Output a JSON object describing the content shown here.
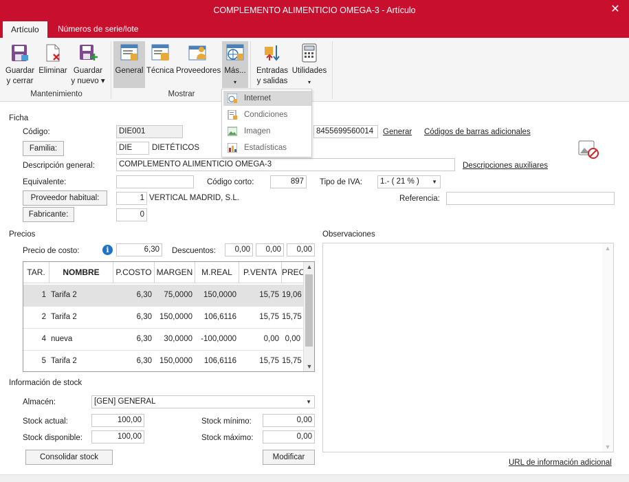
{
  "window": {
    "title": "COMPLEMENTO ALIMENTICIO OMEGA-3 - Artículo",
    "close_glyph": "✕"
  },
  "tabs": [
    "Artículo",
    "Números de serie/lote"
  ],
  "ribbon": {
    "groups": [
      {
        "label": "Mantenimiento",
        "buttons": [
          {
            "l1": "Guardar",
            "l2": "y cerrar",
            "icon": "save-close-icon"
          },
          {
            "l1": "Eliminar",
            "l2": "",
            "icon": "delete-icon"
          },
          {
            "l1": "Guardar",
            "l2": "y nuevo ▾",
            "icon": "save-new-icon"
          }
        ]
      },
      {
        "label": "Mostrar",
        "buttons": [
          {
            "l1": "General",
            "l2": "",
            "icon": "general-icon"
          },
          {
            "l1": "Técnica",
            "l2": "",
            "icon": "technical-icon"
          },
          {
            "l1": "Proveedores",
            "l2": "",
            "icon": "suppliers-icon"
          },
          {
            "l1": "Más...",
            "l2": "▾",
            "icon": "more-icon"
          }
        ]
      },
      {
        "label": "",
        "buttons": [
          {
            "l1": "Entradas",
            "l2": "y salidas",
            "icon": "in-out-icon"
          },
          {
            "l1": "Utilidades",
            "l2": "▾",
            "icon": "utilities-icon"
          }
        ]
      }
    ]
  },
  "mas_menu": [
    "Internet",
    "Condiciones",
    "Imagen",
    "Estadísticas"
  ],
  "ficha": {
    "section": "Ficha",
    "codigo_label": "Código:",
    "codigo": "DIE001",
    "barcode": "8455699560014",
    "generar": "Generar",
    "codigos_barras": "Códigos de barras adicionales",
    "familia_btn": "Familia:",
    "familia_code": "DIE",
    "familia_name": "DIETÉTICOS",
    "desc_label": "Descripción general:",
    "descripcion": "COMPLEMENTO ALIMENTICIO OMEGA-3",
    "desc_aux": "Descripciones auxiliares",
    "equivalente_label": "Equivalente:",
    "equivalente": "",
    "codigo_corto_label": "Código corto:",
    "codigo_corto": "897",
    "iva_label": "Tipo de IVA:",
    "iva": "1.- ( 21 % )",
    "proveedor_btn": "Proveedor habitual:",
    "proveedor_num": "1",
    "proveedor_name": "VERTICAL MADRID, S.L.",
    "referencia_label": "Referencia:",
    "referencia": "",
    "fabricante_btn": "Fabricante:",
    "fabricante": "0"
  },
  "precios": {
    "section": "Precios",
    "coste_label": "Precio de costo:",
    "coste": "6,30",
    "descuentos_label": "Descuentos:",
    "descuentos": [
      "0,00",
      "0,00",
      "0,00"
    ],
    "columns": [
      "TAR.",
      "NOMBRE",
      "P.COSTO",
      "MARGEN",
      "M.REAL",
      "P.VENTA",
      "PRECIO I/I"
    ],
    "rows": [
      [
        "1",
        "Tarifa 2",
        "6,30",
        "75,0000",
        "150,0000",
        "15,75",
        "19,06"
      ],
      [
        "2",
        "Tarifa 2",
        "6,30",
        "150,0000",
        "106,6116",
        "15,75",
        "15,75"
      ],
      [
        "4",
        "nueva",
        "6,30",
        "30,0000",
        "-100,0000",
        "0,00",
        "0,00"
      ],
      [
        "5",
        "Tarifa 2",
        "6,30",
        "150,0000",
        "106,6116",
        "15,75",
        "15,75"
      ]
    ]
  },
  "observaciones": {
    "label": "Observaciones",
    "text": ""
  },
  "stock": {
    "section": "Información de stock",
    "almacen_label": "Almacén:",
    "almacen": "[GEN] GENERAL",
    "actual_label": "Stock actual:",
    "actual": "100,00",
    "disponible_label": "Stock disponible:",
    "disponible": "100,00",
    "minimo_label": "Stock mínimo:",
    "minimo": "0,00",
    "maximo_label": "Stock máximo:",
    "maximo": "0,00",
    "consolidar": "Consolidar stock",
    "modificar": "Modificar"
  },
  "url_info": "URL de información adicional",
  "colors": {
    "brand": "#c8102e",
    "info": "#1e73c8"
  }
}
